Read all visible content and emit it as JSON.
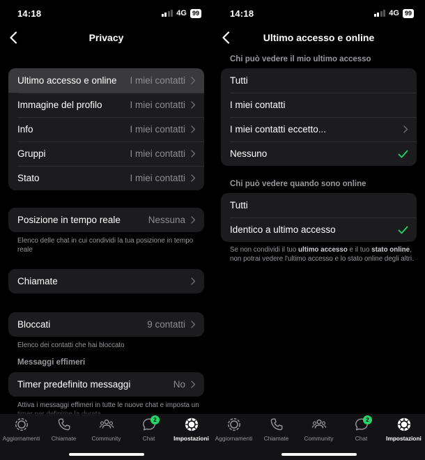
{
  "status": {
    "time": "14:18",
    "network": "4G",
    "battery": "99"
  },
  "left": {
    "title": "Privacy",
    "group1": [
      {
        "label": "Ultimo accesso e online",
        "value": "I miei contatti"
      },
      {
        "label": "Immagine del profilo",
        "value": "I miei contatti"
      },
      {
        "label": "Info",
        "value": "I miei contatti"
      },
      {
        "label": "Gruppi",
        "value": "I miei contatti"
      },
      {
        "label": "Stato",
        "value": "I miei contatti"
      }
    ],
    "location": {
      "label": "Posizione in tempo reale",
      "value": "Nessuna",
      "note": "Elenco delle chat in cui condividi la tua posizione in tempo reale"
    },
    "calls": {
      "label": "Chiamate"
    },
    "blocked": {
      "label": "Bloccati",
      "value": "9 contatti",
      "note": "Elenco dei contatti che hai bloccato"
    },
    "ephemeral": {
      "header": "Messaggi effimeri",
      "label": "Timer predefinito messaggi",
      "value": "No",
      "note": "Attiva i messaggi effimeri in tutte le nuove chat e imposta un timer per definirne la durata"
    }
  },
  "right": {
    "title": "Ultimo accesso e online",
    "section1": {
      "header": "Chi può vedere il mio ultimo accesso",
      "options": [
        "Tutti",
        "I miei contatti",
        "I miei contatti eccetto...",
        "Nessuno"
      ]
    },
    "section2": {
      "header": "Chi può vedere quando sono online",
      "options": [
        "Tutti",
        "Identico a ultimo accesso"
      ]
    },
    "note": {
      "p1": "Se non condividi il tuo ",
      "b1": "ultimo accesso",
      "p2": " e il tuo ",
      "b2": "stato online",
      "p3": ", non potrai vedere l'ultimo accesso e lo stato online degli altri."
    }
  },
  "tabs": [
    {
      "label": "Aggiornamenti",
      "icon": "updates-icon"
    },
    {
      "label": "Chiamate",
      "icon": "phone-icon"
    },
    {
      "label": "Community",
      "icon": "community-icon"
    },
    {
      "label": "Chat",
      "icon": "chat-icon",
      "badge": "2"
    },
    {
      "label": "Impostazioni",
      "icon": "settings-icon"
    }
  ],
  "colors": {
    "accent": "#25d366",
    "group_bg": "#1c1c1e",
    "highlight": "#3a3a3c",
    "secondary_text": "#8e8e93"
  }
}
